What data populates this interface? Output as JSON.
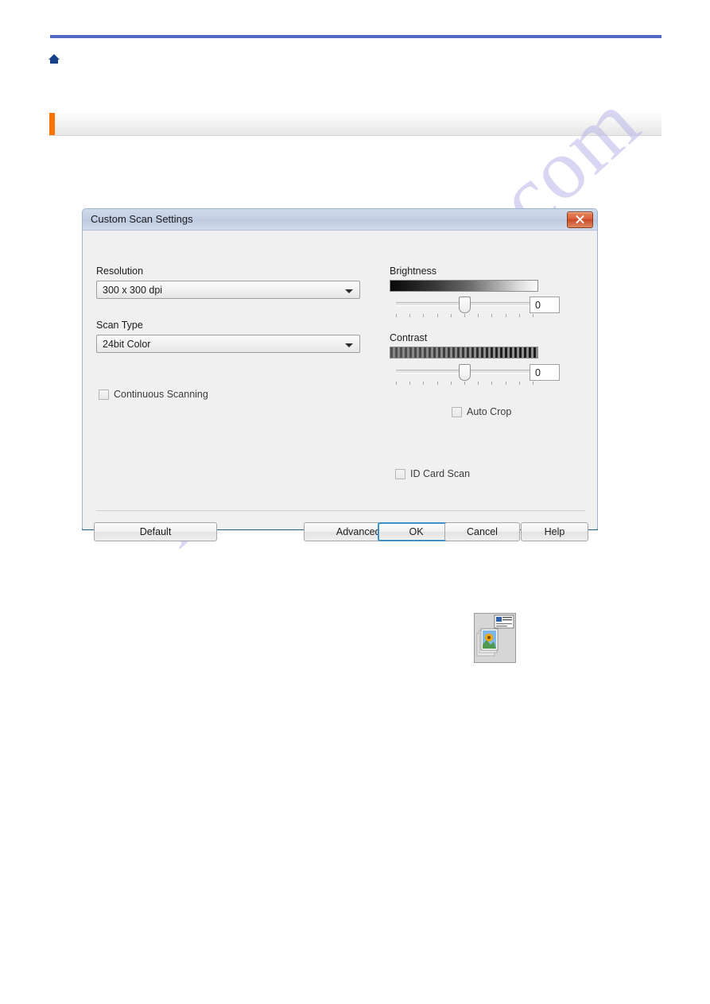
{
  "page": {
    "home_icon": "home-icon",
    "section_title": "",
    "watermark": "manualshive.com",
    "rule_color": "#5169c4",
    "accent_color": "#f97306"
  },
  "dialog": {
    "title": "Custom Scan Settings",
    "close_label": "x",
    "close_color": "#d9603a",
    "left_column": {
      "resolution": {
        "label": "Resolution",
        "value": "300 x 300 dpi",
        "arrow_icon": "chevron-down-icon"
      },
      "scan_type": {
        "label": "Scan Type",
        "value": "24bit Color",
        "arrow_icon": "chevron-down-icon"
      },
      "continuous_scanning": {
        "label": "Continuous Scanning",
        "checked": false
      }
    },
    "right_column": {
      "brightness": {
        "label": "Brightness",
        "value": "0",
        "slider_percent": 50,
        "tick_count": 11
      },
      "contrast": {
        "label": "Contrast",
        "value": "0",
        "slider_percent": 50,
        "tick_count": 11
      },
      "auto_crop": {
        "label": "Auto Crop",
        "checked": false
      },
      "id_card_scan": {
        "label": "ID Card Scan",
        "checked": false
      },
      "preview_icon": "document-preview-icon"
    },
    "buttons": {
      "default": "Default",
      "advanced_settings": "Advanced Settings",
      "ok": "OK",
      "cancel": "Cancel",
      "help": "Help",
      "focused": "ok"
    }
  }
}
